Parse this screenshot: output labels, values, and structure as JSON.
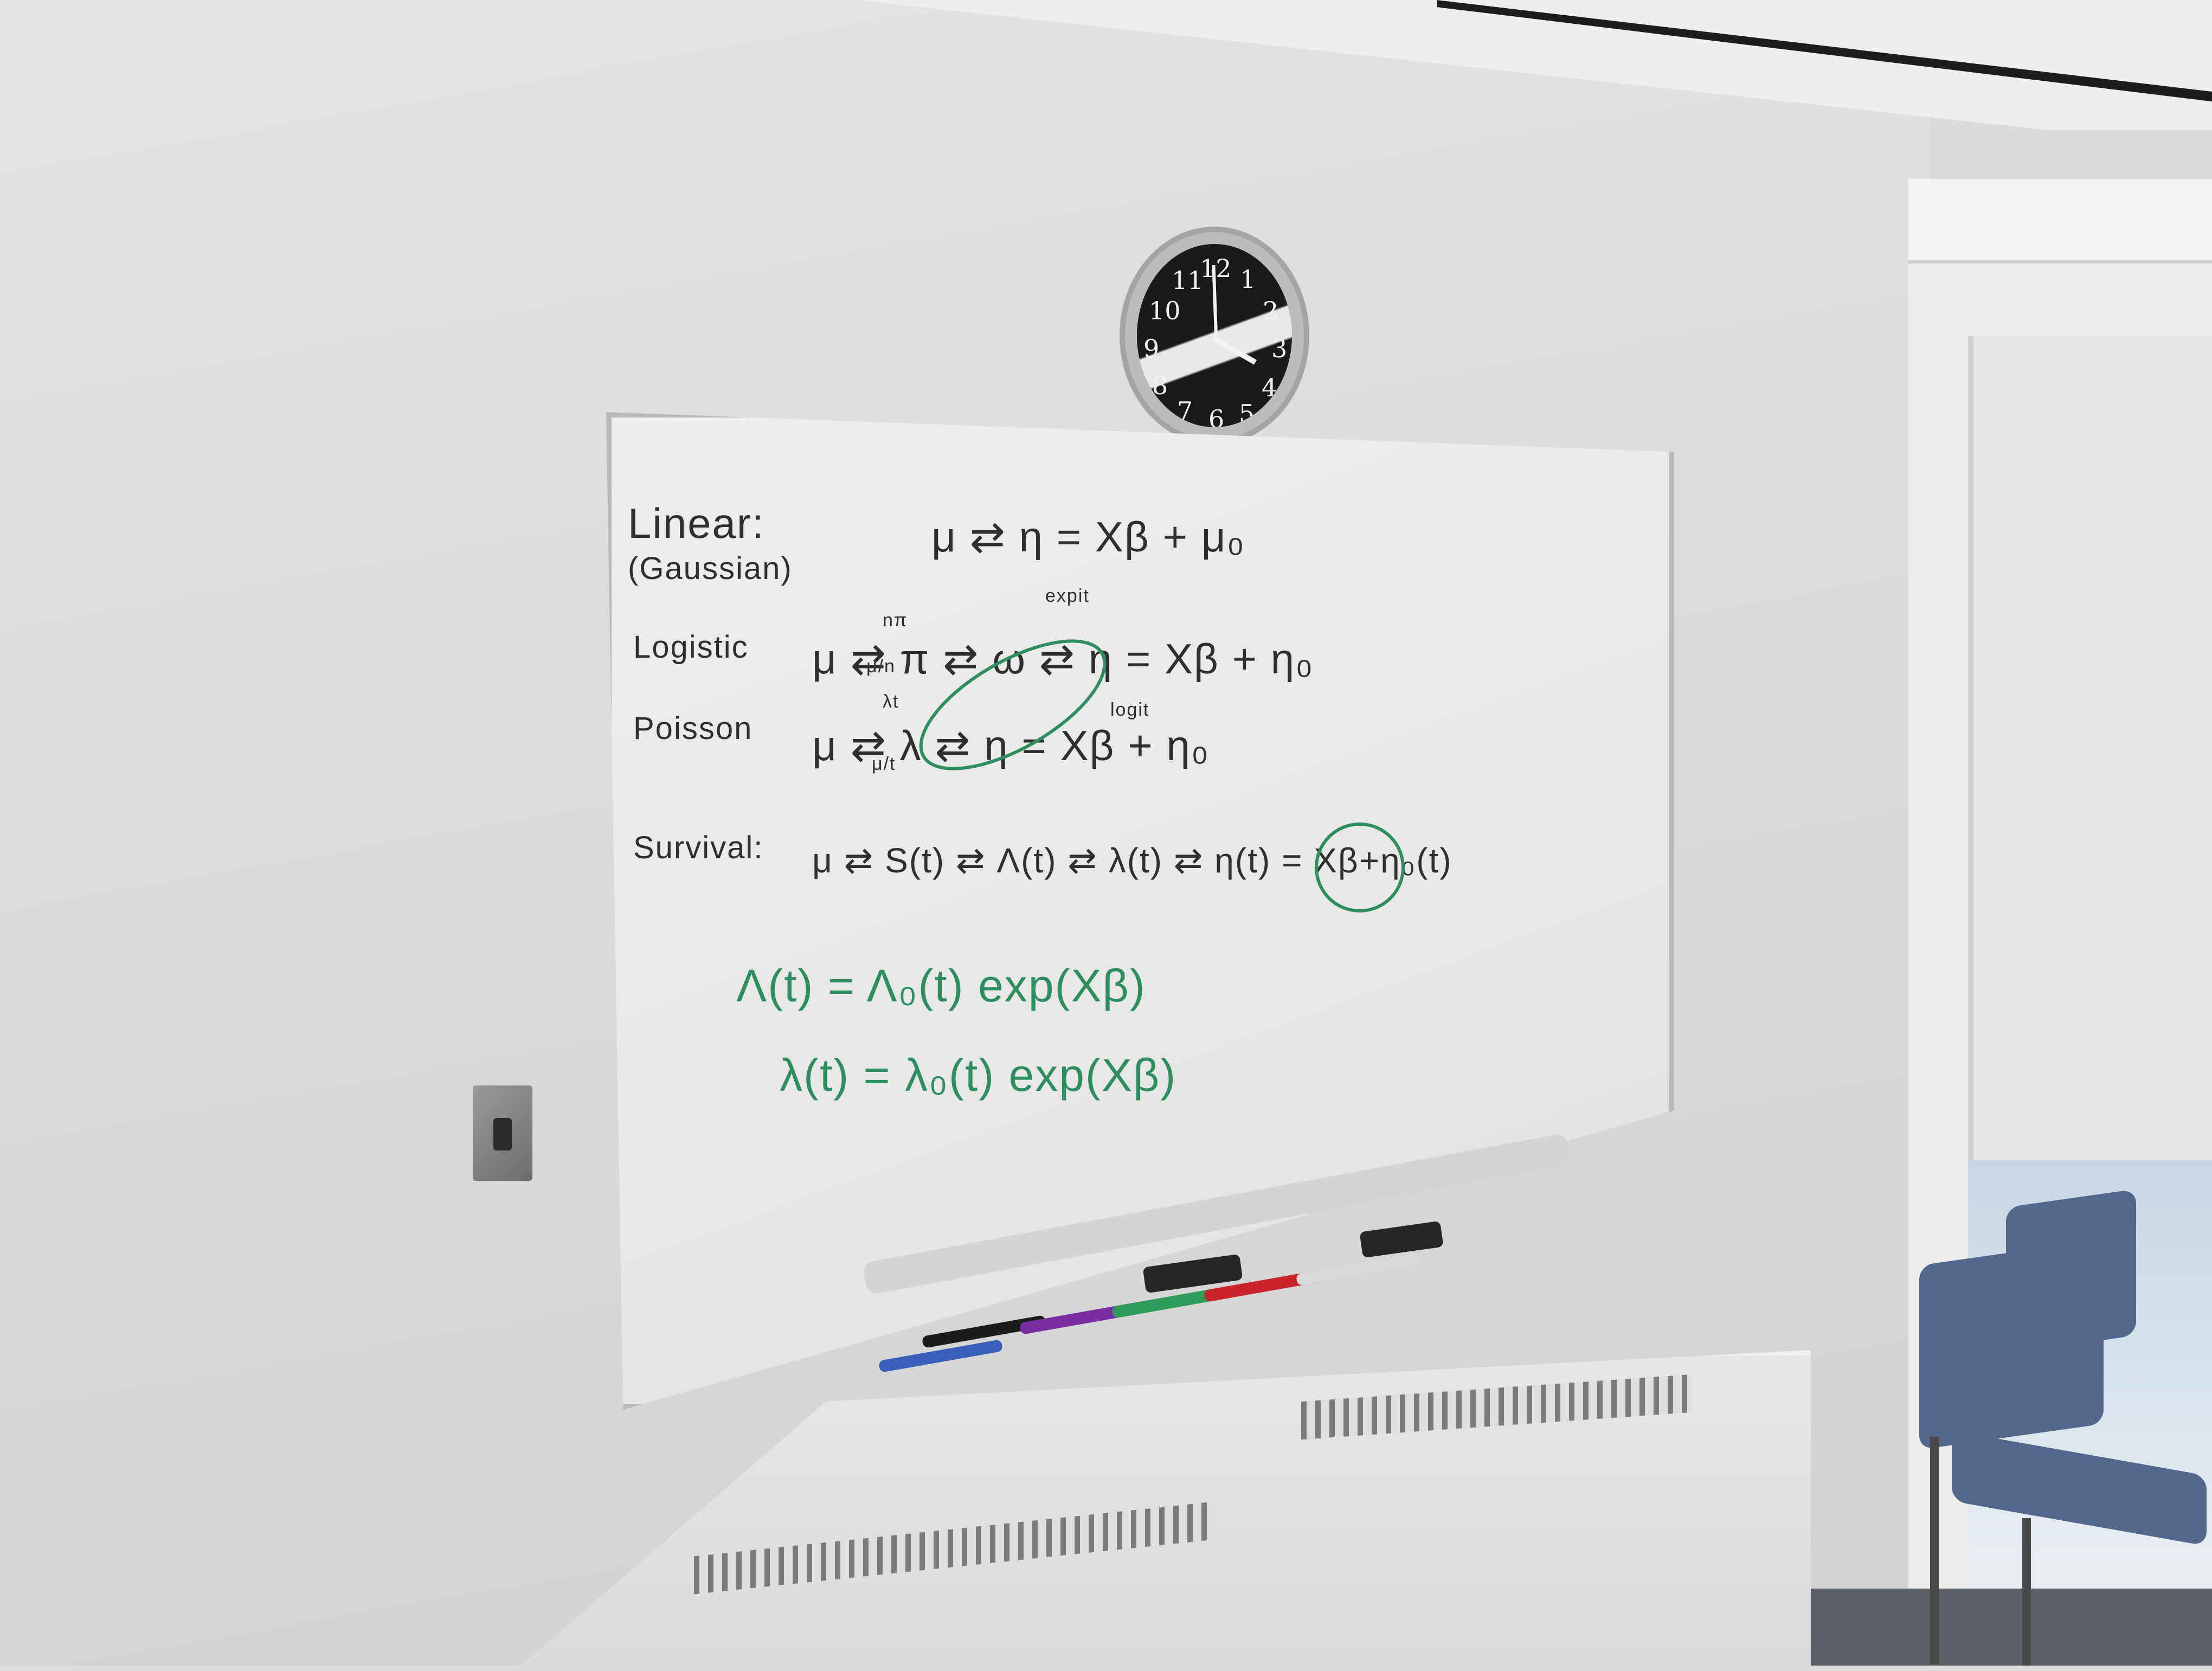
{
  "clock": {
    "numerals": [
      "12",
      "1",
      "2",
      "3",
      "4",
      "5",
      "6",
      "7",
      "8",
      "9",
      "10",
      "11"
    ],
    "time_shown": "4:00"
  },
  "whiteboard": {
    "lines": [
      {
        "label": "Linear:",
        "sub": "(Gaussian)",
        "expr": "μ ⇄ η = Xβ + μ₀"
      },
      {
        "label": "Logistic",
        "expr": "μ ⇄ π ⇄ ω ⇄ η = Xβ + η₀",
        "arrow_top": "nπ",
        "arrow_bottom": "μ/n",
        "above": "expit",
        "below": "logit"
      },
      {
        "label": "Poisson",
        "expr": "μ ⇄ λ ⇄ η = Xβ + η₀",
        "arrow_top": "λt",
        "arrow_bottom": "μ/t"
      },
      {
        "label": "Survival:",
        "expr": "μ ⇄ S(t) ⇄ Λ(t) ⇄ λ(t) ⇄ η(t) = Xβ+η₀(t)"
      }
    ],
    "green_equations": [
      "Λ(t) = Λ₀(t) exp(Xβ)",
      "λ(t) = λ₀(t) exp(Xβ)"
    ]
  },
  "colors": {
    "ink_black": "#2f2f2f",
    "ink_green": "#2e8e60",
    "chair_blue": "#53678c"
  }
}
